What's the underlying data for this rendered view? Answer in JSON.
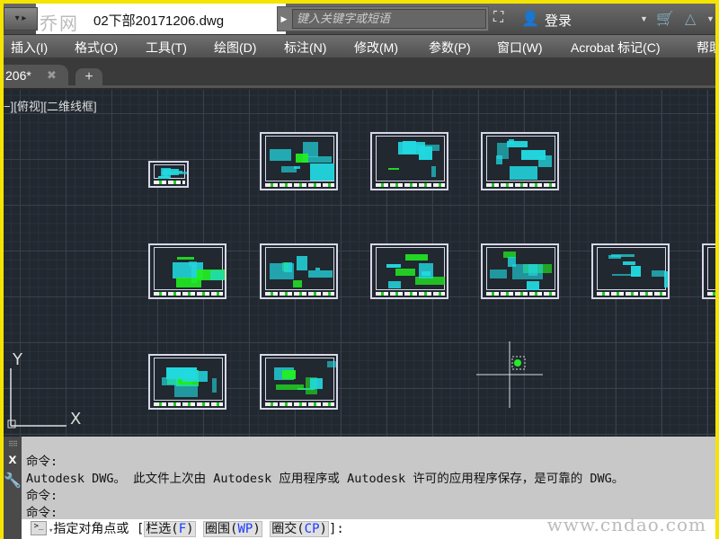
{
  "titlebar": {
    "app_menu_icon": "autocad-app-menu-icon",
    "watermark": "乔网",
    "document_title": "02下部20171206.dwg",
    "search_placeholder": "键入关键字或短语",
    "search_icon": "binoculars-icon",
    "user_icon": "user-icon",
    "login_label": "登录",
    "cart_icon": "cart-icon",
    "autodesk_icon": "autodesk-a360-icon"
  },
  "menubar": {
    "items": [
      "插入(I)",
      "格式(O)",
      "工具(T)",
      "绘图(D)",
      "标注(N)",
      "修改(M)",
      "参数(P)",
      "窗口(W)",
      "Acrobat 标记(C)",
      "帮助"
    ]
  },
  "tabs": {
    "active_tab": "206*",
    "close_icon": "close-icon",
    "new_tab_icon": "plus-icon"
  },
  "viewport": {
    "label": "−][俯视][二维线框]",
    "ucs_y": "Y",
    "ucs_x": "X",
    "background": "#212830",
    "sheet_accent": "#22d8e0"
  },
  "command": {
    "history": [
      "命令:",
      "Autodesk DWG。  此文件上次由 Autodesk 应用程序或 Autodesk 许可的应用程序保存，是可靠的 DWG。",
      "命令:",
      "命令:"
    ],
    "close_icon_label": "x",
    "prompt_text": "指定对角点或 [",
    "options": [
      {
        "label": "栏选(",
        "key": "F",
        "end": ")"
      },
      {
        "label": "圈围(",
        "key": "WP",
        "end": ")"
      },
      {
        "label": "圈交(",
        "key": "CP",
        "end": ")"
      }
    ],
    "prompt_end": "]:"
  },
  "watermark": "www.cndao.com"
}
